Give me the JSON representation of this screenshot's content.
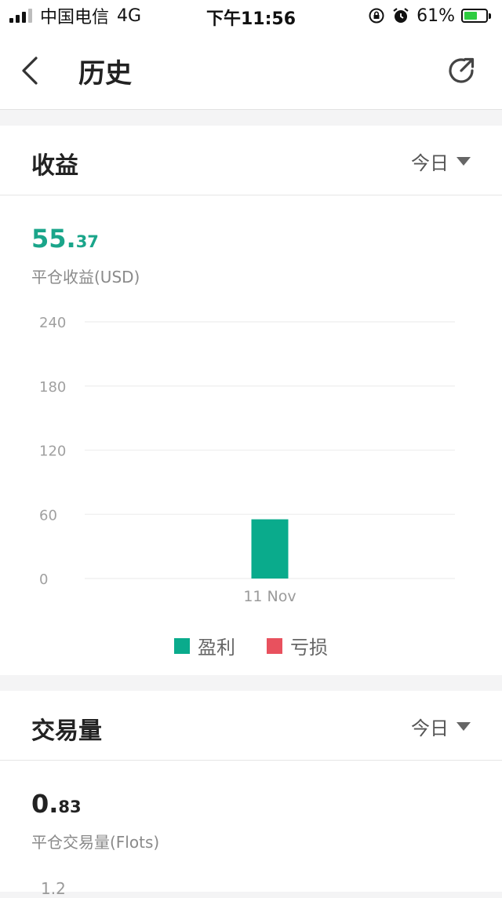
{
  "status_bar": {
    "carrier": "中国电信",
    "network": "4G",
    "time": "下午11:56",
    "battery_percent": "61%",
    "battery_level": 0.61
  },
  "navbar": {
    "title": "历史"
  },
  "profit_card": {
    "title": "收益",
    "period": "今日",
    "value_int": "55.",
    "value_dec": "37",
    "value_label": "平仓收益(USD)",
    "accent": "#1aa58a",
    "chart_data": {
      "type": "bar",
      "categories": [
        "11 Nov"
      ],
      "series": [
        {
          "name": "盈利",
          "values": [
            55.37
          ],
          "color": "#0aab8c"
        },
        {
          "name": "亏损",
          "values": [
            0
          ],
          "color": "#e8515e"
        }
      ],
      "yticks": [
        "240",
        "180",
        "120",
        "60",
        "0"
      ],
      "ylim": [
        0,
        240
      ],
      "grid": true,
      "legend": "bottom-center"
    }
  },
  "volume_card": {
    "title": "交易量",
    "period": "今日",
    "value_int": "0.",
    "value_dec": "83",
    "value_label": "平仓交易量(Flots)",
    "first_tick": "1.2"
  }
}
